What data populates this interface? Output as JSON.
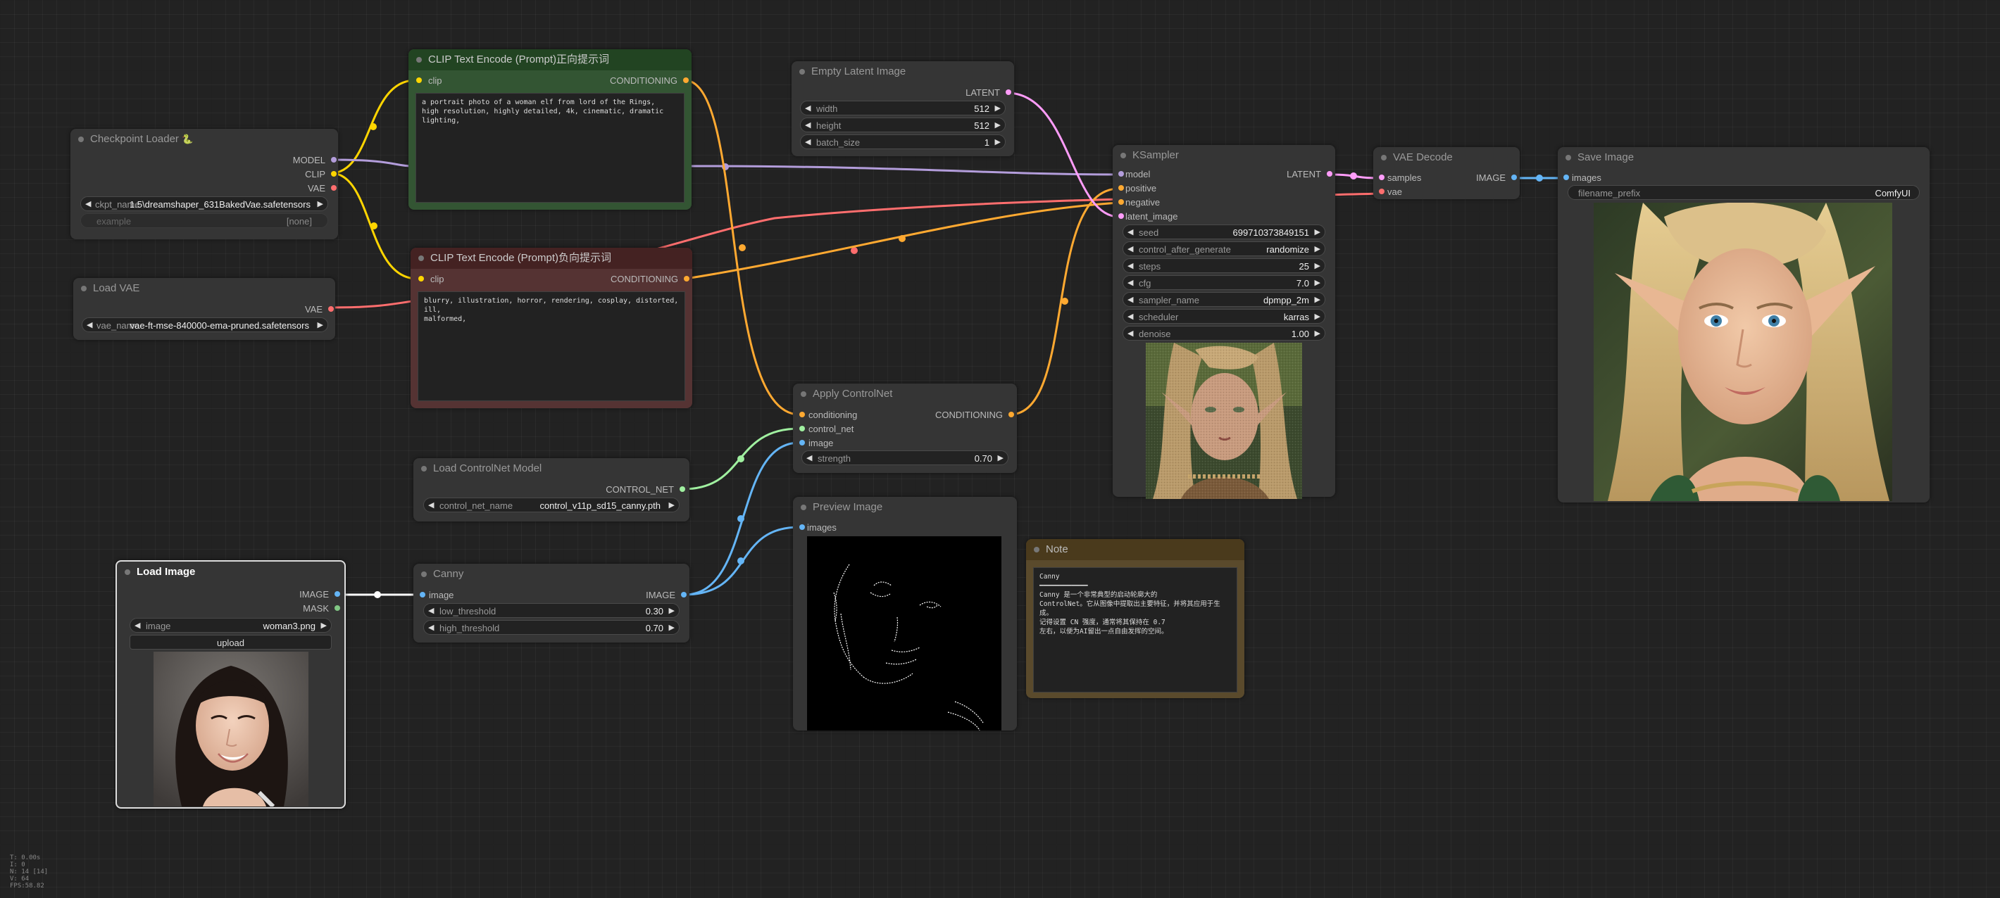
{
  "nodes": {
    "checkpoint_loader": {
      "title": "Checkpoint Loader",
      "badge": "🐍",
      "outputs": [
        "MODEL",
        "CLIP",
        "VAE"
      ],
      "ckpt_label": "ckpt_name",
      "ckpt_value": "1.5\\dreamshaper_631BakedVae.safetensors",
      "example_label": "example",
      "example_value": "[none]"
    },
    "load_vae": {
      "title": "Load VAE",
      "output": "VAE",
      "vae_label": "vae_name",
      "vae_value": "vae-ft-mse-840000-ema-pruned.safetensors"
    },
    "clip_pos": {
      "title": "CLIP Text Encode (Prompt)正向提示词",
      "input": "clip",
      "output": "CONDITIONING",
      "text": "a portrait photo of a woman elf from lord of the Rings,\nhigh resolution, highly detailed, 4k, cinematic, dramatic lighting,"
    },
    "clip_neg": {
      "title": "CLIP Text Encode (Prompt)负向提示词",
      "input": "clip",
      "output": "CONDITIONING",
      "text": "blurry, illustration, horror, rendering, cosplay, distorted, ill,\nmalformed,"
    },
    "empty_latent": {
      "title": "Empty Latent Image",
      "output": "LATENT",
      "widgets": [
        {
          "label": "width",
          "value": "512"
        },
        {
          "label": "height",
          "value": "512"
        },
        {
          "label": "batch_size",
          "value": "1"
        }
      ]
    },
    "ksampler": {
      "title": "KSampler",
      "inputs": [
        "model",
        "positive",
        "negative",
        "latent_image"
      ],
      "output": "LATENT",
      "widgets": [
        {
          "label": "seed",
          "value": "699710373849151"
        },
        {
          "label": "control_after_generate",
          "value": "randomize"
        },
        {
          "label": "steps",
          "value": "25"
        },
        {
          "label": "cfg",
          "value": "7.0"
        },
        {
          "label": "sampler_name",
          "value": "dpmpp_2m"
        },
        {
          "label": "scheduler",
          "value": "karras"
        },
        {
          "label": "denoise",
          "value": "1.00"
        }
      ]
    },
    "vae_decode": {
      "title": "VAE Decode",
      "inputs": [
        "samples",
        "vae"
      ],
      "output": "IMAGE"
    },
    "save_image": {
      "title": "Save Image",
      "input": "images",
      "prefix_label": "filename_prefix",
      "prefix_value": "ComfyUI"
    },
    "apply_controlnet": {
      "title": "Apply ControlNet",
      "inputs": [
        "conditioning",
        "control_net",
        "image"
      ],
      "output": "CONDITIONING",
      "strength_label": "strength",
      "strength_value": "0.70"
    },
    "load_controlnet": {
      "title": "Load ControlNet Model",
      "output": "CONTROL_NET",
      "name_label": "control_net_name",
      "name_value": "control_v11p_sd15_canny.pth"
    },
    "preview_image": {
      "title": "Preview Image",
      "input": "images"
    },
    "note": {
      "title": "Note",
      "text": "Canny\n━━━━━━━━━━━━\nCanny 是一个非常典型的启动轮廓大的\nControlNet。它从图像中提取出主要特征，并将其应用于生成。\n记得设置 CN 强度，通常将其保持在 0.7\n左右，以便为AI留出一点自由发挥的空间。"
    },
    "load_image": {
      "title": "Load Image",
      "outputs": [
        "IMAGE",
        "MASK"
      ],
      "image_label": "image",
      "image_value": "woman3.png",
      "upload_label": "upload"
    },
    "canny": {
      "title": "Canny",
      "input": "image",
      "output": "IMAGE",
      "widgets": [
        {
          "label": "low_threshold",
          "value": "0.30"
        },
        {
          "label": "high_threshold",
          "value": "0.70"
        }
      ]
    }
  },
  "stats": [
    "T: 0.00s",
    "I: 0",
    "N: 14 [14]",
    "V: 64",
    "FPS:58.82"
  ],
  "colors": {
    "clip": "#FFD500",
    "model": "#B39DDB",
    "vae": "#FF6E6E",
    "conditioning": "#FFA931",
    "latent": "#FF9CF9",
    "image": "#64B5F6",
    "control_net": "#A0F0A0",
    "mask": "#81C784"
  }
}
